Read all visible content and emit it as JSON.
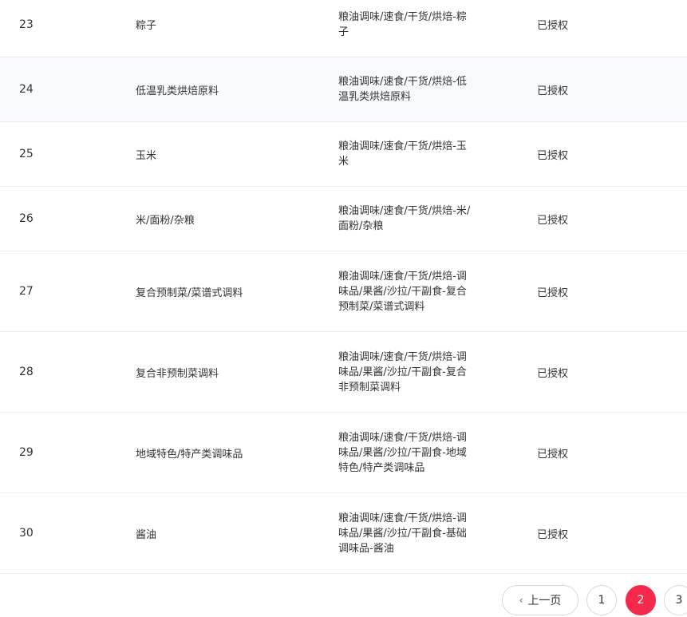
{
  "rows": [
    {
      "index": "23",
      "name": "粽子",
      "path_lines": [
        "粮油调味/速食/干货/烘焙-粽",
        "子"
      ],
      "status": "已授权"
    },
    {
      "index": "24",
      "name": "低温乳类烘焙原料",
      "path_lines": [
        "粮油调味/速食/干货/烘焙-低",
        "温乳类烘焙原料"
      ],
      "status": "已授权"
    },
    {
      "index": "25",
      "name": "玉米",
      "path_lines": [
        "粮油调味/速食/干货/烘焙-玉",
        "米"
      ],
      "status": "已授权"
    },
    {
      "index": "26",
      "name": "米/面粉/杂粮",
      "path_lines": [
        "粮油调味/速食/干货/烘焙-米/",
        "面粉/杂粮"
      ],
      "status": "已授权"
    },
    {
      "index": "27",
      "name": "复合预制菜/菜谱式调料",
      "path_lines": [
        "粮油调味/速食/干货/烘焙-调",
        "味品/果酱/沙拉/干副食-复合",
        "预制菜/菜谱式调料"
      ],
      "status": "已授权"
    },
    {
      "index": "28",
      "name": "复合非预制菜调料",
      "path_lines": [
        "粮油调味/速食/干货/烘焙-调",
        "味品/果酱/沙拉/干副食-复合",
        "非预制菜调料"
      ],
      "status": "已授权"
    },
    {
      "index": "29",
      "name": "地域特色/特产类调味品",
      "path_lines": [
        "粮油调味/速食/干货/烘焙-调",
        "味品/果酱/沙拉/干副食-地域",
        "特色/特产类调味品"
      ],
      "status": "已授权"
    },
    {
      "index": "30",
      "name": "酱油",
      "path_lines": [
        "粮油调味/速食/干货/烘焙-调",
        "味品/果酱/沙拉/干副食-基础",
        "调味品-酱油"
      ],
      "status": "已授权"
    }
  ],
  "pagination": {
    "prev_label": "上一页",
    "prev_icon": "chevron-left-icon",
    "pages": [
      "1",
      "2",
      "3"
    ],
    "current_page": "2"
  },
  "colors": {
    "accent": "#f5294a",
    "row_alt_bg": "#f7f9fc",
    "divider": "#ececec"
  }
}
